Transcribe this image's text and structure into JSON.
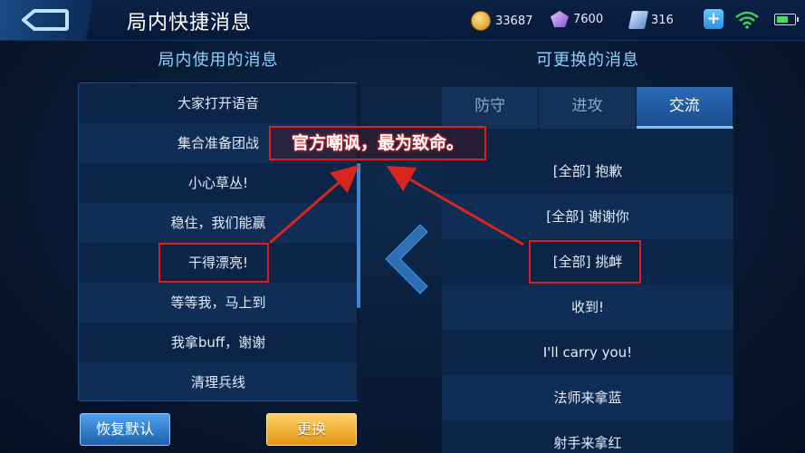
{
  "header": {
    "title": "局内快捷消息",
    "resources": {
      "gold": "33687",
      "diamond": "7600",
      "voucher": "316"
    }
  },
  "left": {
    "title": "局内使用的消息",
    "items": [
      "大家打开语音",
      "集合准备团战",
      "小心草丛!",
      "稳住，我们能赢",
      "干得漂亮!",
      "等等我，马上到",
      "我拿buff，谢谢",
      "清理兵线"
    ],
    "restore_label": "恢复默认",
    "replace_label": "更换"
  },
  "right": {
    "title": "可更换的消息",
    "tabs": [
      {
        "label": "防守",
        "active": false
      },
      {
        "label": "进攻",
        "active": false
      },
      {
        "label": "交流",
        "active": true
      }
    ],
    "items": [
      "[全部] 抱歉",
      "[全部] 谢谢你",
      "[全部] 挑衅",
      "收到!",
      "I'll carry you!",
      "法师来拿蓝",
      "射手来拿红"
    ]
  },
  "annotation": {
    "text": "官方嘲讽，最为致命。",
    "color": "#e51b1b"
  },
  "colors": {
    "accent": "#8fd0ff",
    "panel": "#0b2448",
    "tab_active": "#2b6ab6",
    "replace_button": "#e39411",
    "restore_button": "#1e5fab"
  }
}
